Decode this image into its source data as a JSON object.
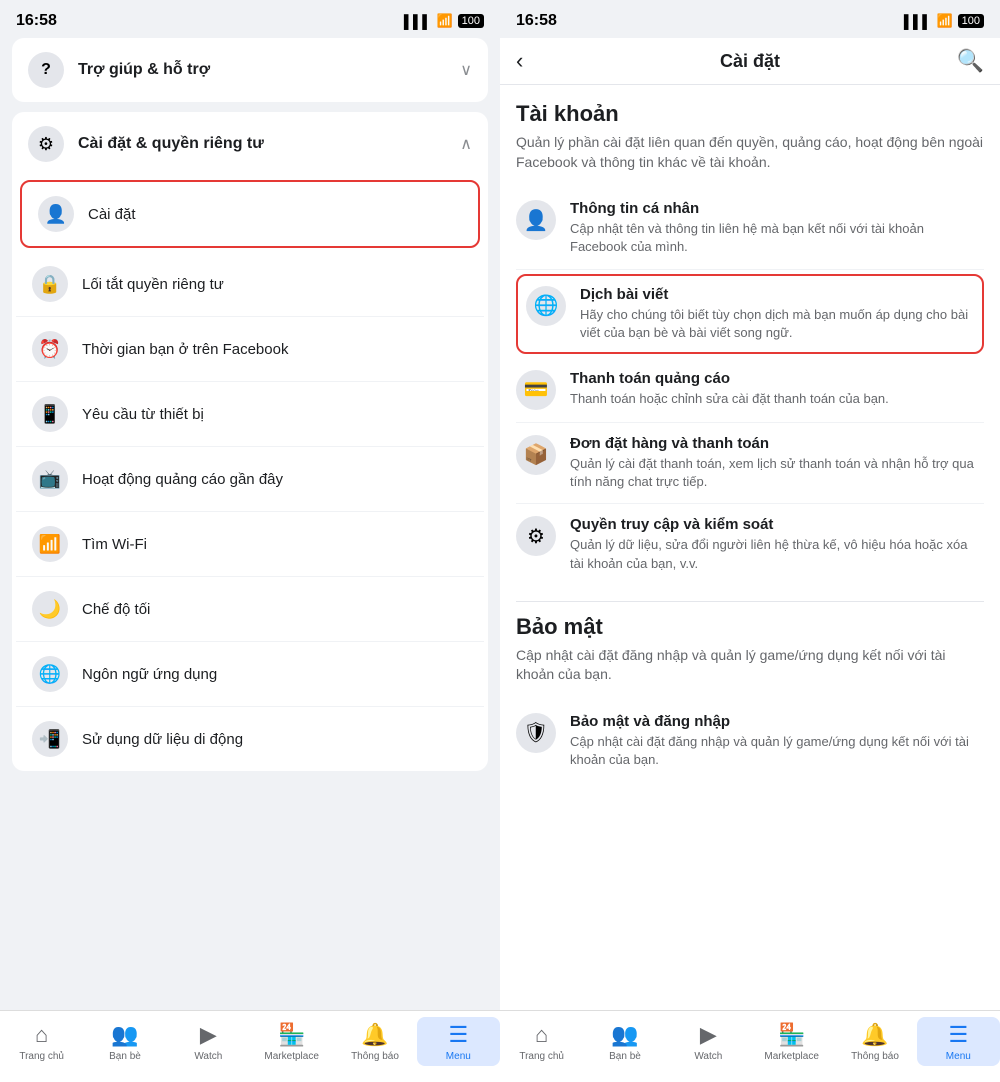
{
  "left": {
    "status": {
      "time": "16:58",
      "signal": "▌▌▌",
      "wifi": "WiFi",
      "battery": "100"
    },
    "help_section": {
      "icon": "?",
      "label": "Trợ giúp & hỗ trợ",
      "chevron": "∨"
    },
    "settings_section": {
      "icon": "⚙",
      "label": "Cài đặt & quyền riêng tư",
      "chevron": "∧"
    },
    "highlighted_item": {
      "icon": "👤",
      "label": "Cài đặt"
    },
    "sub_items": [
      {
        "icon": "🔒",
        "label": "Lối tắt quyền riêng tư"
      },
      {
        "icon": "⏰",
        "label": "Thời gian bạn ở trên Facebook"
      },
      {
        "icon": "📱",
        "label": "Yêu cầu từ thiết bị"
      },
      {
        "icon": "📺",
        "label": "Hoạt động quảng cáo gần đây"
      },
      {
        "icon": "📶",
        "label": "Tìm Wi-Fi"
      },
      {
        "icon": "🌙",
        "label": "Chế độ tối"
      },
      {
        "icon": "🌐",
        "label": "Ngôn ngữ ứng dụng"
      },
      {
        "icon": "📲",
        "label": "Sử dụng dữ liệu di động"
      }
    ],
    "bottom_nav": [
      {
        "icon": "⌂",
        "label": "Trang chủ",
        "active": false
      },
      {
        "icon": "👥",
        "label": "Bạn bè",
        "active": false
      },
      {
        "icon": "▶",
        "label": "Watch",
        "active": false
      },
      {
        "icon": "🏪",
        "label": "Marketplace",
        "active": false
      },
      {
        "icon": "🔔",
        "label": "Thông báo",
        "active": false
      },
      {
        "icon": "☰",
        "label": "Menu",
        "active": true
      }
    ]
  },
  "right": {
    "status": {
      "time": "16:58",
      "signal": "▌▌▌",
      "wifi": "WiFi",
      "battery": "100"
    },
    "header": {
      "back": "‹",
      "title": "Cài đặt",
      "search": "🔍"
    },
    "tai_khoan": {
      "title": "Tài khoản",
      "description": "Quản lý phần cài đặt liên quan đến quyền, quảng cáo, hoạt động bên ngoài Facebook và thông tin khác về tài khoản.",
      "items": [
        {
          "icon": "👤",
          "title": "Thông tin cá nhân",
          "desc": "Cập nhật tên và thông tin liên hệ mà bạn kết nối với tài khoản Facebook của mình."
        },
        {
          "icon": "🌐",
          "title": "Dịch bài viết",
          "desc": "Hãy cho chúng tôi biết tùy chọn dịch mà bạn muốn áp dụng cho bài viết của bạn bè và bài viết song ngữ.",
          "highlighted": true
        },
        {
          "icon": "💳",
          "title": "Thanh toán quảng cáo",
          "desc": "Thanh toán hoặc chỉnh sửa cài đặt thanh toán của bạn."
        },
        {
          "icon": "📦",
          "title": "Đơn đặt hàng và thanh toán",
          "desc": "Quản lý cài đặt thanh toán, xem lịch sử thanh toán và nhận hỗ trợ qua tính năng chat trực tiếp."
        },
        {
          "icon": "⚙",
          "title": "Quyền truy cập và kiểm soát",
          "desc": "Quản lý dữ liệu, sửa đổi người liên hệ thừa kế, vô hiệu hóa hoặc xóa tài khoản của bạn, v.v."
        }
      ]
    },
    "bao_mat": {
      "title": "Bảo mật",
      "description": "Cập nhật cài đặt đăng nhập và quản lý game/ứng dụng kết nối với tài khoản của bạn.",
      "items": [
        {
          "icon": "🛡",
          "title": "Bảo mật và đăng nhập",
          "desc": "Cập nhật cài đặt đăng nhập và quản lý game/ứng dụng kết nối với tài khoản của bạn."
        }
      ]
    },
    "bottom_nav": [
      {
        "icon": "⌂",
        "label": "Trang chủ",
        "active": false
      },
      {
        "icon": "👥",
        "label": "Bạn bè",
        "active": false
      },
      {
        "icon": "▶",
        "label": "Watch",
        "active": false
      },
      {
        "icon": "🏪",
        "label": "Marketplace",
        "active": false
      },
      {
        "icon": "🔔",
        "label": "Thông báo",
        "active": false
      },
      {
        "icon": "☰",
        "label": "Menu",
        "active": true
      }
    ]
  }
}
